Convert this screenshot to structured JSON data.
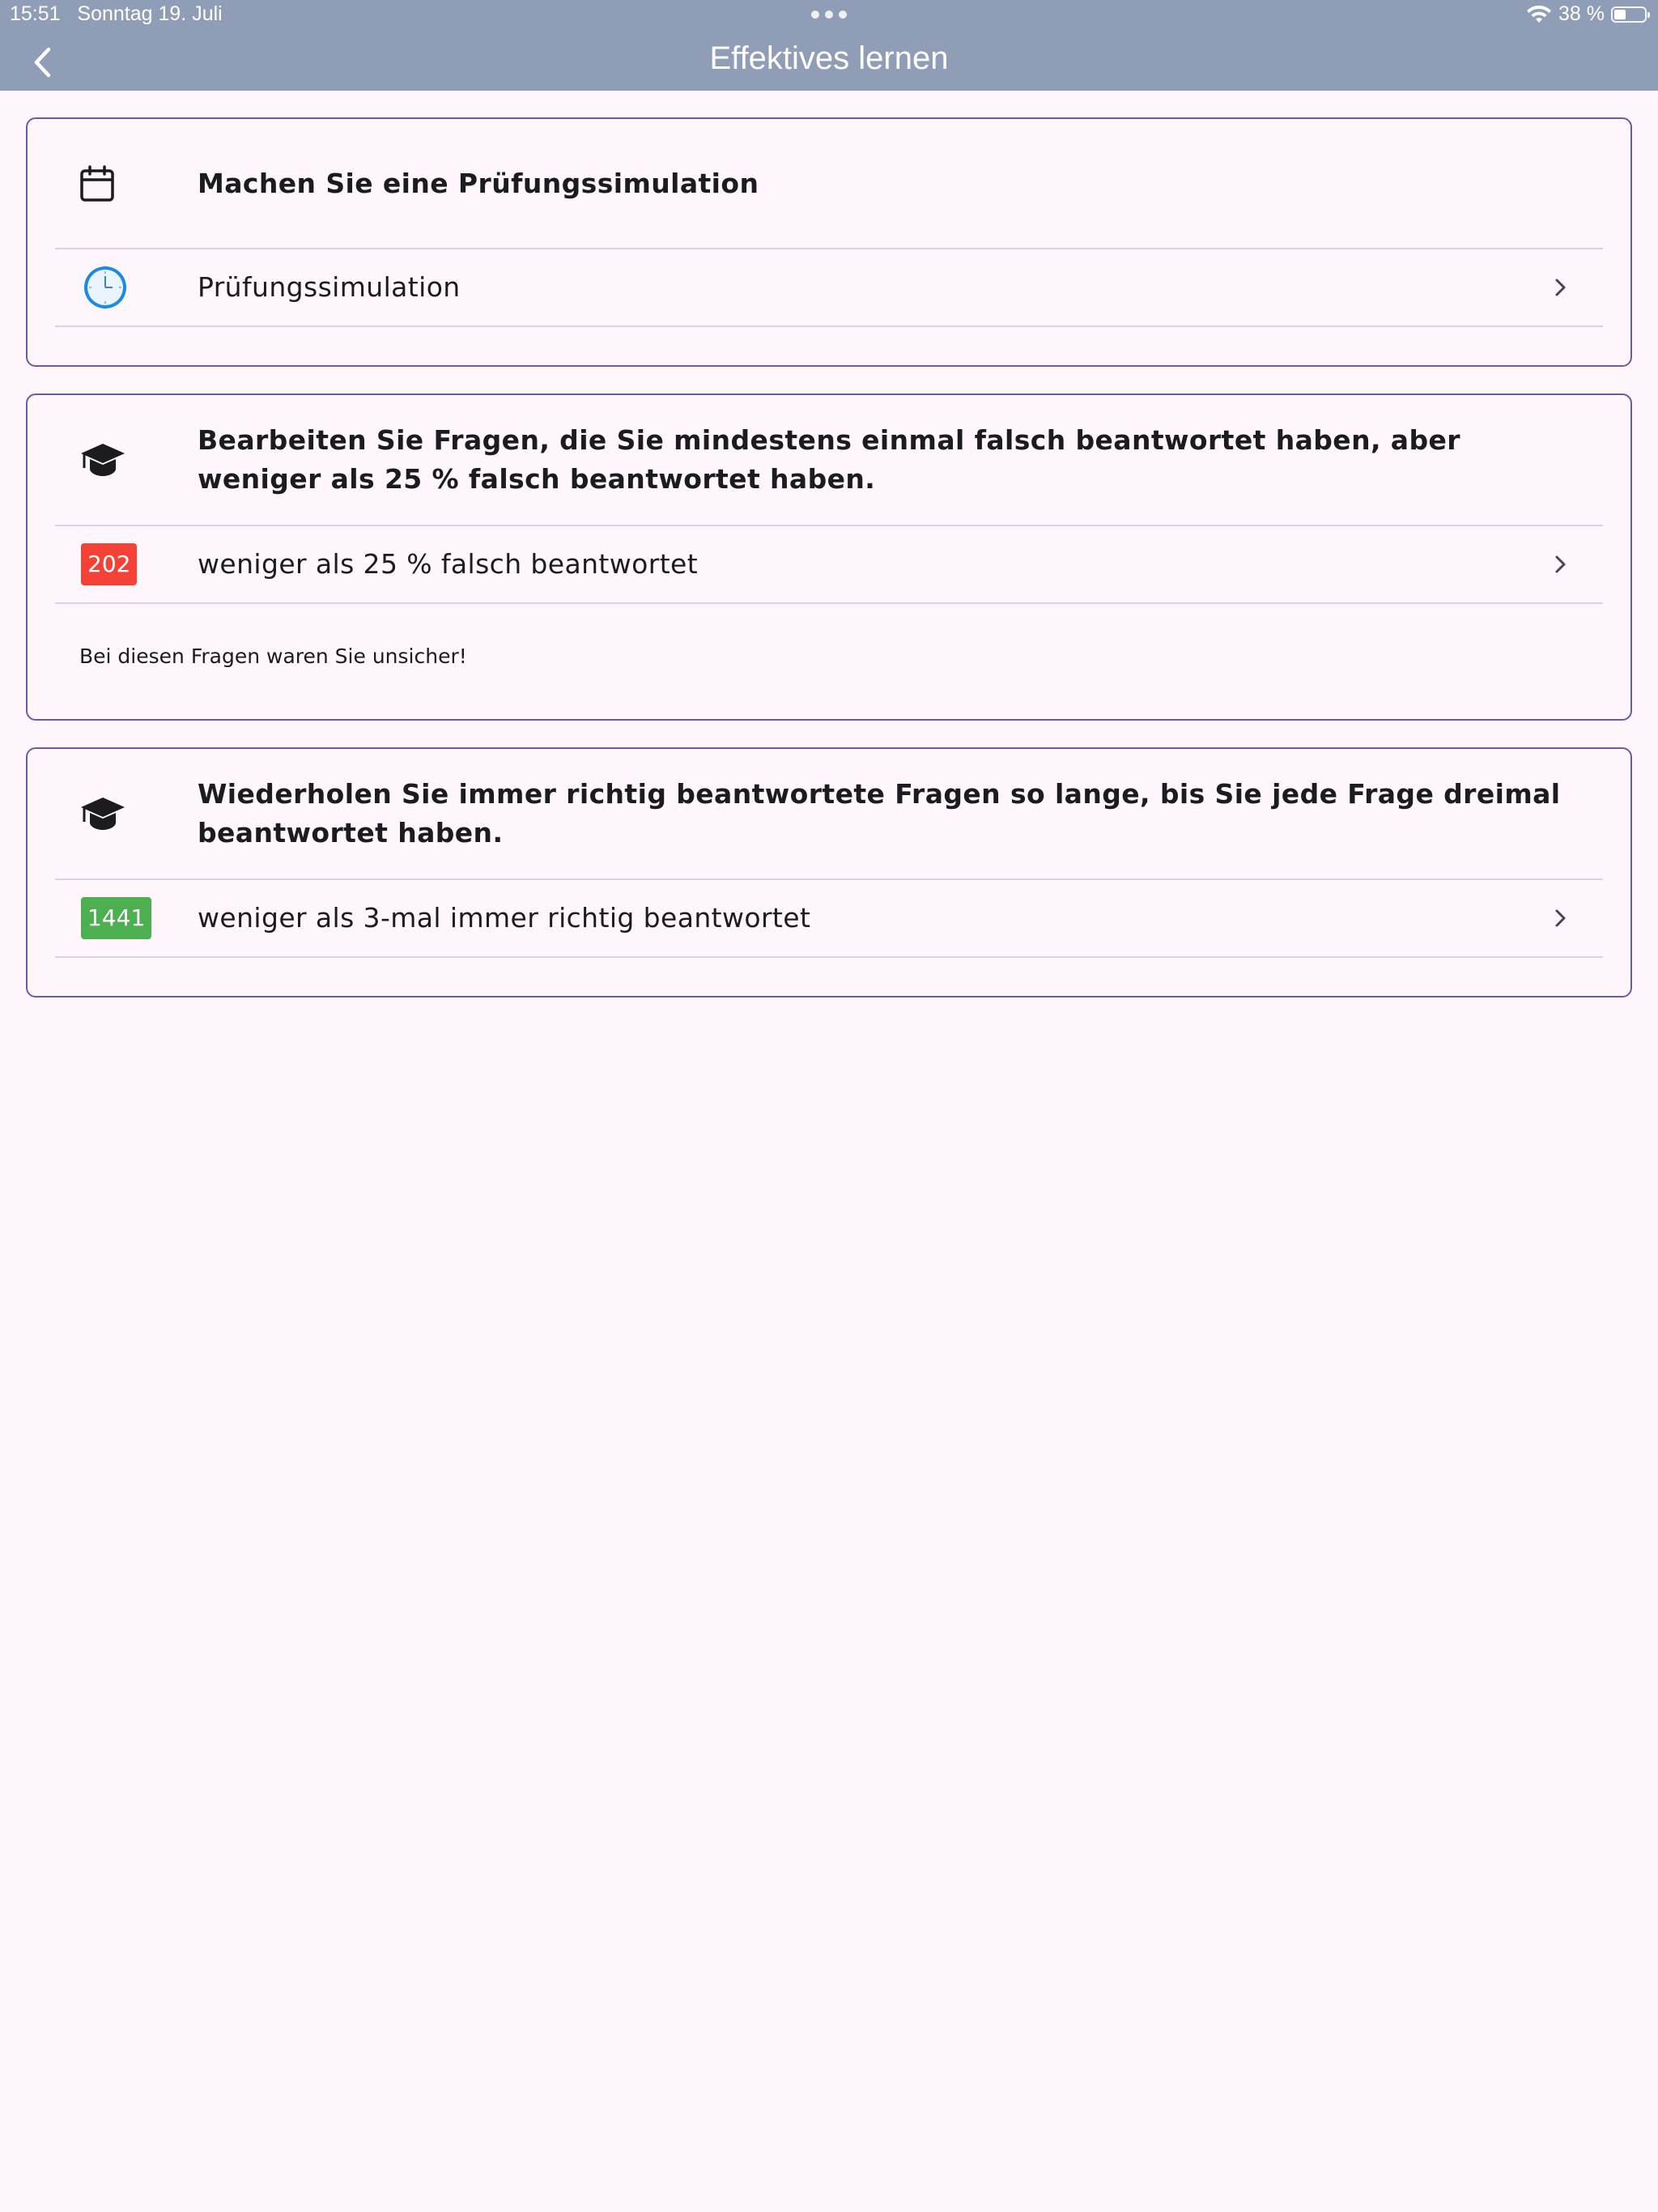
{
  "status": {
    "time": "15:51",
    "date": "Sonntag 19. Juli",
    "battery": "38 %"
  },
  "appbar": {
    "title": "Effektives lernen"
  },
  "cards": [
    {
      "header": "Machen Sie eine Prüfungssimulation",
      "header_icon": "calendar-icon",
      "item": {
        "icon": "clock-icon",
        "label": "Prüfungssimulation"
      }
    },
    {
      "header": "Bearbeiten Sie Fragen, die Sie mindestens einmal falsch beantwortet haben, aber weniger als 25 % falsch beantwortet haben.",
      "header_icon": "graduation-cap-icon",
      "item": {
        "badge": "202",
        "badge_color": "#f44336",
        "label": "weniger als 25 % falsch beantwortet"
      },
      "note": "Bei diesen Fragen waren Sie unsicher!"
    },
    {
      "header": "Wiederholen Sie immer richtig beantwortete Fragen so lange, bis Sie jede Frage dreimal beantwortet haben.",
      "header_icon": "graduation-cap-icon",
      "item": {
        "badge": "1441",
        "badge_color": "#4caf50",
        "label": "weniger als 3-mal immer richtig beantwortet"
      }
    }
  ]
}
